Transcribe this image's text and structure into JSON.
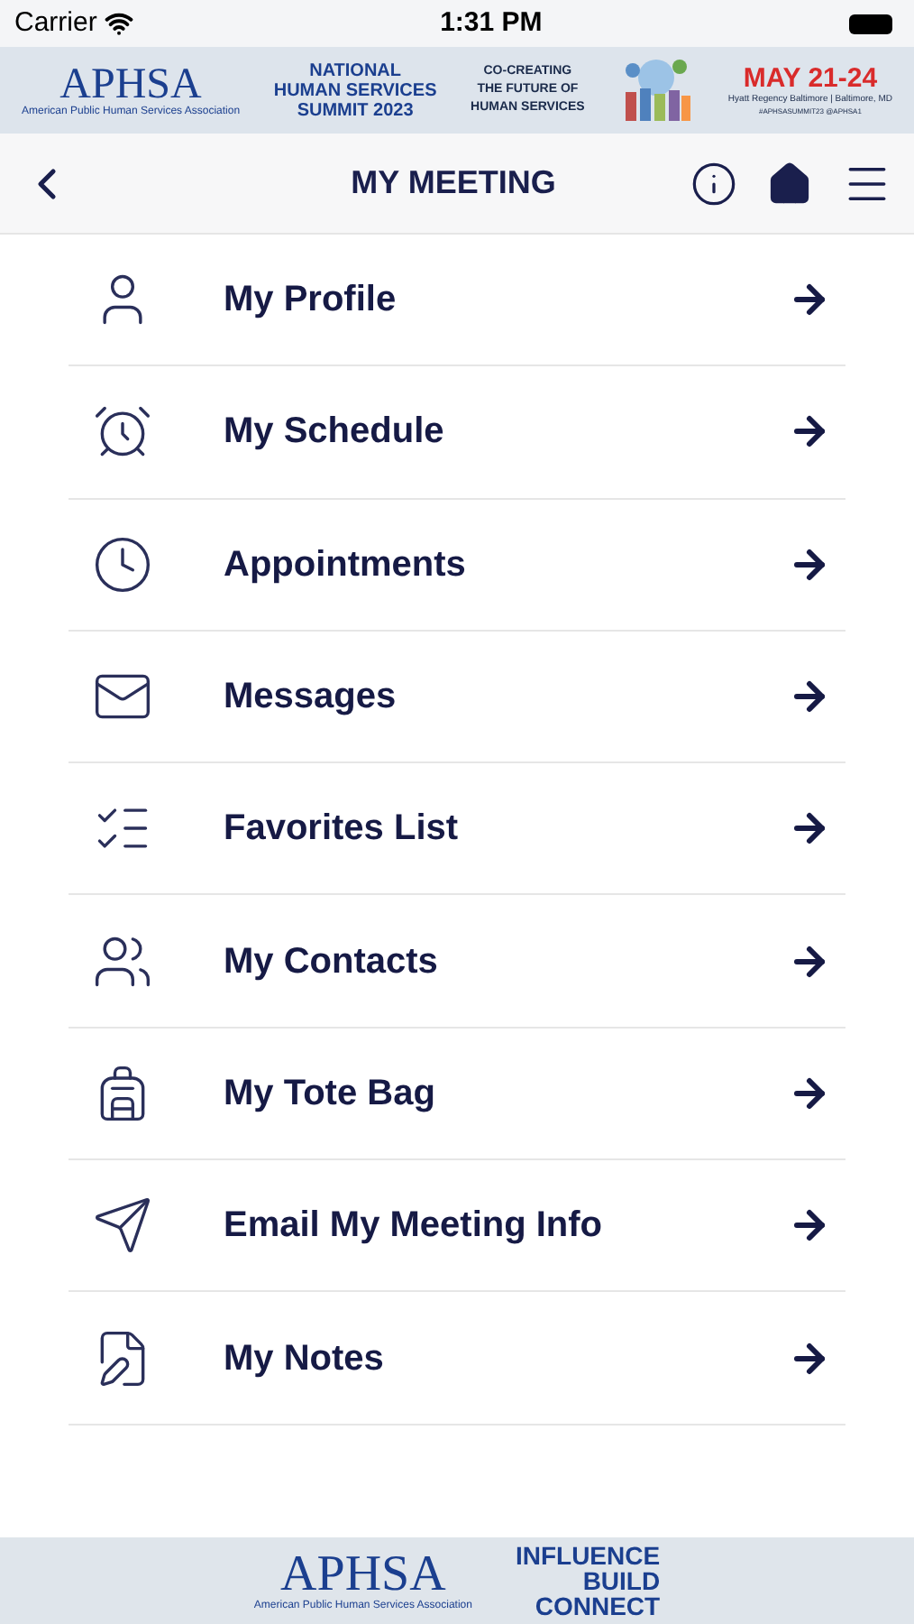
{
  "status_bar": {
    "carrier": "Carrier",
    "time": "1:31 PM"
  },
  "banner": {
    "logo": "APHSA",
    "logo_caption": "American Public Human Services Association",
    "event_title": [
      "NATIONAL",
      "HUMAN SERVICES",
      "SUMMIT 2023"
    ],
    "theme": [
      "CO-CREATING",
      "THE FUTURE OF",
      "HUMAN SERVICES"
    ],
    "dates": "MAY 21-24",
    "venue": "Hyatt Regency Baltimore | Baltimore, MD",
    "tags": "#APHSASUMMIT23 @APHSA1"
  },
  "nav": {
    "title": "MY MEETING"
  },
  "menu": [
    {
      "label": "My Profile",
      "kind": "profile"
    },
    {
      "label": "My Schedule",
      "kind": "schedule"
    },
    {
      "label": "Appointments",
      "kind": "appointments"
    },
    {
      "label": "Messages",
      "kind": "messages"
    },
    {
      "label": "Favorites List",
      "kind": "favorites"
    },
    {
      "label": "My Contacts",
      "kind": "contacts"
    },
    {
      "label": "My Tote Bag",
      "kind": "tote"
    },
    {
      "label": "Email My Meeting Info",
      "kind": "email"
    },
    {
      "label": "My Notes",
      "kind": "notes"
    }
  ],
  "footer": {
    "logo": "APHSA",
    "logo_caption": "American Public Human Services Association",
    "slogan": [
      "INFLUENCE",
      "BUILD",
      "CONNECT"
    ]
  }
}
